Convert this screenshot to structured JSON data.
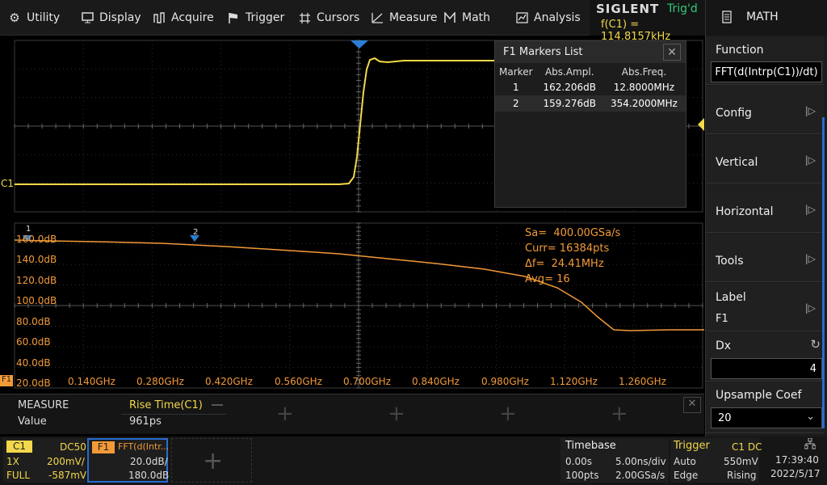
{
  "menu": [
    {
      "label": "Utility",
      "icon": "settings-icon"
    },
    {
      "label": "Display",
      "icon": "monitor-icon"
    },
    {
      "label": "Acquire",
      "icon": "acquire-icon"
    },
    {
      "label": "Trigger",
      "icon": "flag-icon"
    },
    {
      "label": "Cursors",
      "icon": "cursor-icon"
    },
    {
      "label": "Measure",
      "icon": "measure-icon"
    },
    {
      "label": "Math",
      "icon": "math-icon"
    },
    {
      "label": "Analysis",
      "icon": "analysis-icon"
    }
  ],
  "brand": {
    "logo": "SIGLENT",
    "trig_status": "Trig'd",
    "freq": "f(C1) = 114.8157kHz"
  },
  "right_panel": {
    "title": "MATH",
    "function_label": "Function",
    "function_value": "FFT(d(Intrp(C1))/dt)",
    "config": "Config",
    "vertical": "Vertical",
    "horizontal": "Horizontal",
    "tools": "Tools",
    "label_title": "Label",
    "label_value": "F1",
    "dx_label": "Dx",
    "dx_value": "4",
    "upsample_label": "Upsample Coef",
    "upsample_value": "20"
  },
  "ch1_label": "C1",
  "markers_list": {
    "title": "F1 Markers List",
    "headers": [
      "Marker",
      "Abs.Ampl.",
      "Abs.Freq."
    ],
    "rows": [
      [
        "1",
        "162.206dB",
        "12.8000MHz"
      ],
      [
        "2",
        "159.276dB",
        "354.2000MHz"
      ]
    ]
  },
  "fft": {
    "y_labels": [
      "160.0dB",
      "140.0dB",
      "120.0dB",
      "100.0dB",
      "80.0dB",
      "60.0dB",
      "40.0dB",
      "20.0dB"
    ],
    "x_labels": [
      "0.140GHz",
      "0.280GHz",
      "0.420GHz",
      "0.560GHz",
      "0.700GHz",
      "0.840GHz",
      "0.980GHz",
      "1.120GHz",
      "1.260GHz"
    ],
    "info": [
      "Sa=  400.00GSa/s",
      "Curr= 16384pts",
      "Δf=  24.41MHz",
      "Avg= 16"
    ],
    "marker1": "1",
    "marker2": "2",
    "channel_tag": "F1"
  },
  "measure": {
    "title": "MEASURE",
    "item": "Rise Time(C1)",
    "value_label": "Value",
    "value": "961ps"
  },
  "bottom": {
    "c1": {
      "tag": "C1",
      "coupling": "DC50",
      "probe": "1X",
      "scale": "200mV/",
      "bw": "FULL",
      "offset": "-587mV"
    },
    "f1": {
      "tag": "F1",
      "func": "FFT(d(Intr...",
      "scale": "20.0dB/",
      "offset": "180.0dB"
    },
    "timebase": {
      "title": "Timebase",
      "delay": "0.00s",
      "scale": "5.00ns/div",
      "points": "100pts",
      "rate": "2.00GSa/s"
    },
    "trigger": {
      "title": "Trigger",
      "source": "C1 DC",
      "mode": "Auto",
      "level": "550mV",
      "type": "Edge",
      "slope": "Rising"
    },
    "clock": {
      "time": "17:39:40",
      "date": "2022/5/17"
    }
  },
  "colors": {
    "ch1": "#f2d84a",
    "fft": "#f29a38",
    "trig_marker": "#2a7fd4",
    "status_green": "#33c87a"
  }
}
